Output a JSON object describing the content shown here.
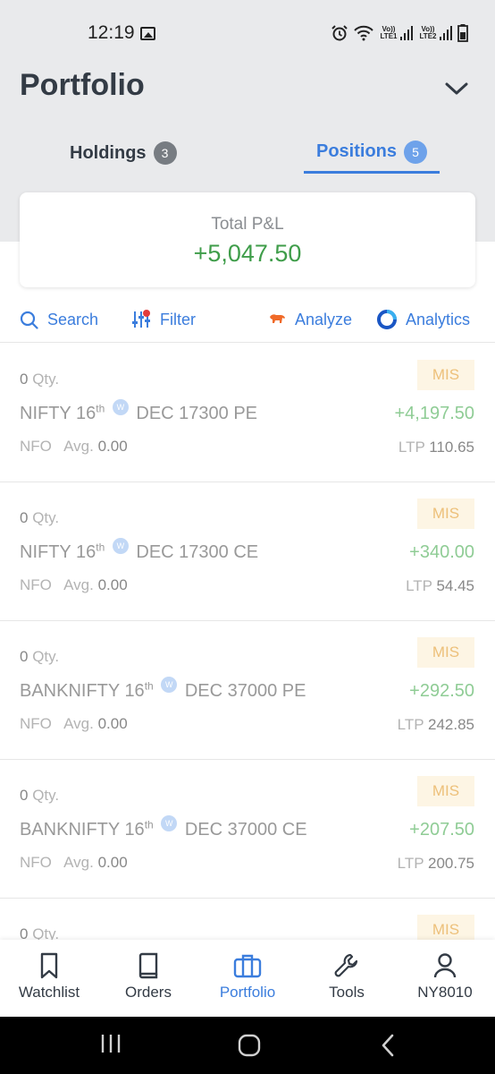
{
  "status_bar": {
    "time": "12:19",
    "sim1_label": "Vo)) LTE1",
    "sim2_label": "Vo)) LTE2",
    "icons": [
      "image-icon",
      "alarm-icon",
      "wifi-icon",
      "signal-icon",
      "battery-icon"
    ]
  },
  "header": {
    "title": "Portfolio",
    "tabs": [
      {
        "label": "Holdings",
        "count": "3",
        "active": false
      },
      {
        "label": "Positions",
        "count": "5",
        "active": true
      }
    ]
  },
  "summary": {
    "label": "Total P&L",
    "value": "+5,047.50"
  },
  "toolbar": {
    "search": "Search",
    "filter": "Filter",
    "analyze": "Analyze",
    "analytics": "Analytics"
  },
  "positions": [
    {
      "qty": "0",
      "qty_unit": "Qty.",
      "underlying": "NIFTY",
      "day": "16",
      "day_suffix": "th",
      "weekly_badge": "W",
      "contract": "DEC 17300 PE",
      "exchange": "NFO",
      "avg_label": "Avg.",
      "avg": "0.00",
      "product": "MIS",
      "pnl": "+4,197.50",
      "ltp_label": "LTP",
      "ltp": "110.65"
    },
    {
      "qty": "0",
      "qty_unit": "Qty.",
      "underlying": "NIFTY",
      "day": "16",
      "day_suffix": "th",
      "weekly_badge": "W",
      "contract": "DEC 17300 CE",
      "exchange": "NFO",
      "avg_label": "Avg.",
      "avg": "0.00",
      "product": "MIS",
      "pnl": "+340.00",
      "ltp_label": "LTP",
      "ltp": "54.45"
    },
    {
      "qty": "0",
      "qty_unit": "Qty.",
      "underlying": "BANKNIFTY",
      "day": "16",
      "day_suffix": "th",
      "weekly_badge": "W",
      "contract": "DEC 37000 PE",
      "exchange": "NFO",
      "avg_label": "Avg.",
      "avg": "0.00",
      "product": "MIS",
      "pnl": "+292.50",
      "ltp_label": "LTP",
      "ltp": "242.85"
    },
    {
      "qty": "0",
      "qty_unit": "Qty.",
      "underlying": "BANKNIFTY",
      "day": "16",
      "day_suffix": "th",
      "weekly_badge": "W",
      "contract": "DEC 37000 CE",
      "exchange": "NFO",
      "avg_label": "Avg.",
      "avg": "0.00",
      "product": "MIS",
      "pnl": "+207.50",
      "ltp_label": "LTP",
      "ltp": "200.75"
    },
    {
      "qty": "0",
      "qty_unit": "Qty.",
      "product": "MIS"
    }
  ],
  "bottom_nav": [
    {
      "label": "Watchlist",
      "icon": "bookmark-icon",
      "active": false
    },
    {
      "label": "Orders",
      "icon": "book-icon",
      "active": false
    },
    {
      "label": "Portfolio",
      "icon": "briefcase-icon",
      "active": true
    },
    {
      "label": "Tools",
      "icon": "wrench-icon",
      "active": false
    },
    {
      "label": "NY8010",
      "icon": "user-icon",
      "active": false
    }
  ],
  "colors": {
    "accent": "#3b7ddd",
    "profit": "#3f9d4a",
    "profit_muted": "#8fcc95",
    "product_badge_bg": "#fdf5e4",
    "product_badge_text": "#edc07a",
    "header_bg": "#e9eaec"
  }
}
